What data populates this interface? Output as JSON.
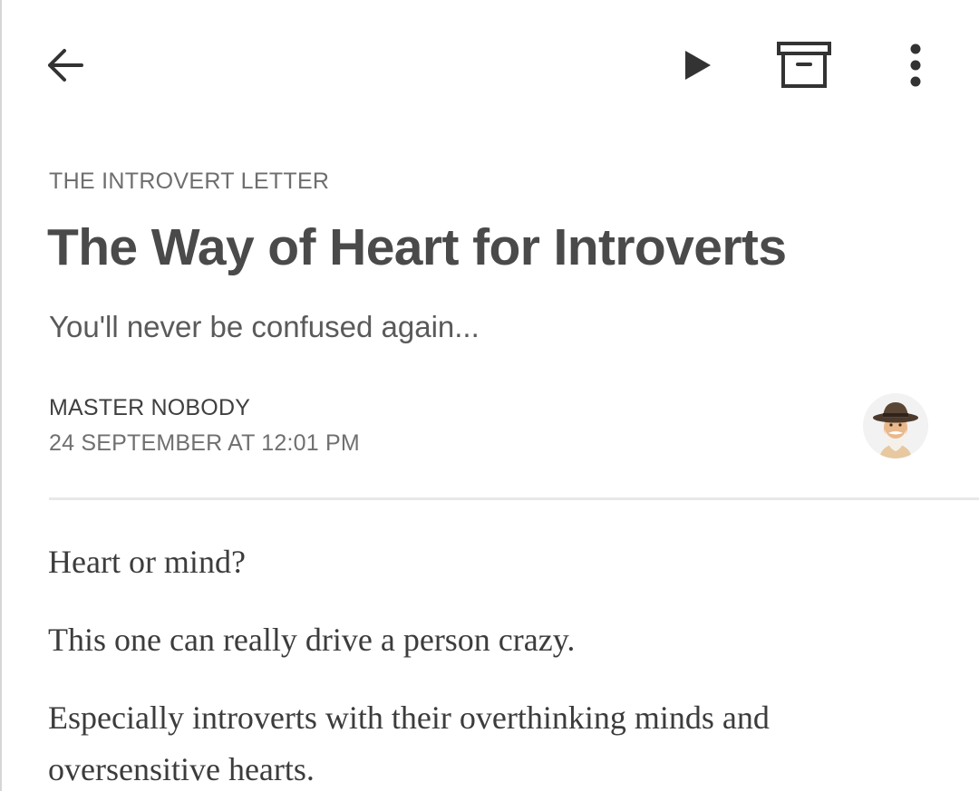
{
  "toolbar": {
    "back_icon": "arrow-left-icon",
    "play_icon": "play-icon",
    "archive_icon": "archive-box-icon",
    "more_icon": "more-vertical-icon"
  },
  "post": {
    "publication": "THE INTROVERT LETTER",
    "title": "The Way of Heart for Introverts",
    "subtitle": "You'll never be confused again...",
    "author": "MASTER NOBODY",
    "date": "24 SEPTEMBER AT 12:01 PM",
    "paragraphs": [
      "Heart or mind?",
      "This one can really drive a person crazy.",
      "Especially introverts with their overthinking minds and oversensitive hearts."
    ]
  },
  "colors": {
    "text_primary": "#4a4a4a",
    "text_secondary": "#707070",
    "divider": "#e8e8e8",
    "icon": "#333333"
  }
}
